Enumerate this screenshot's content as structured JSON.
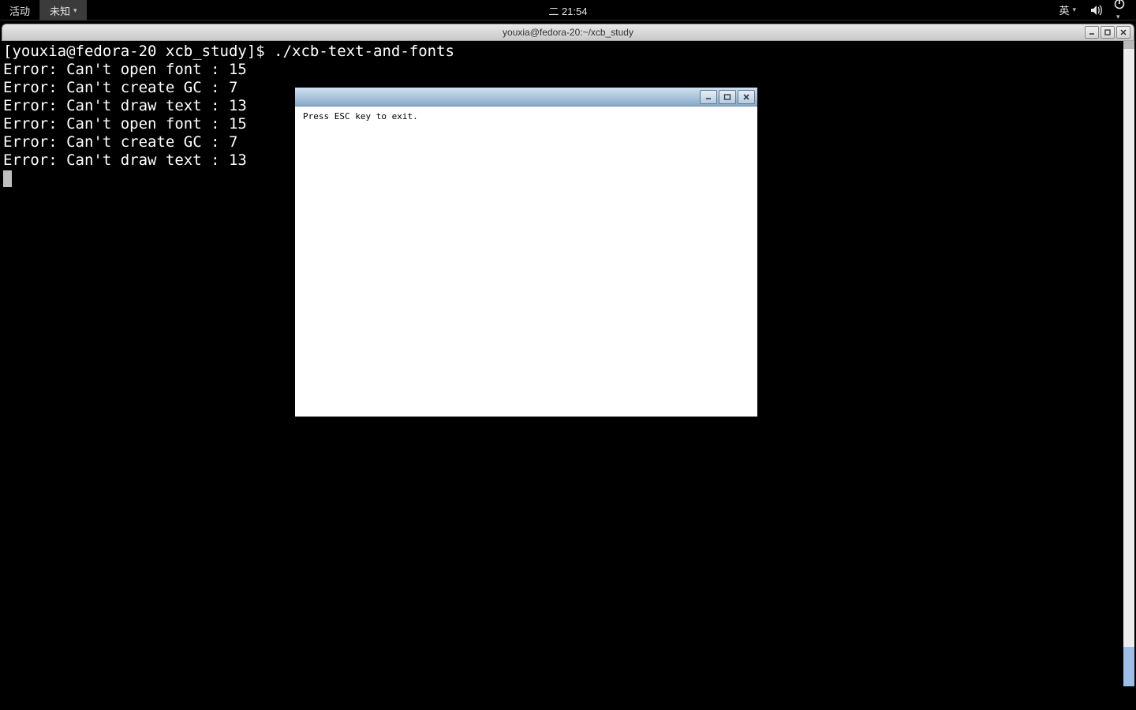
{
  "topbar": {
    "activities": "活动",
    "app_menu": "未知",
    "clock": "二 21:54",
    "ime": "英"
  },
  "terminal": {
    "title": "youxia@fedora-20:~/xcb_study",
    "prompt": "[youxia@fedora-20 xcb_study]$ ",
    "command": "./xcb-text-and-fonts",
    "lines": [
      "Error: Can't open font : 15",
      "Error: Can't create GC : 7",
      "Error: Can't draw text : 13",
      "Error: Can't open font : 15",
      "Error: Can't create GC : 7",
      "Error: Can't draw text : 13"
    ]
  },
  "xwindow": {
    "message": "Press ESC key to exit."
  }
}
